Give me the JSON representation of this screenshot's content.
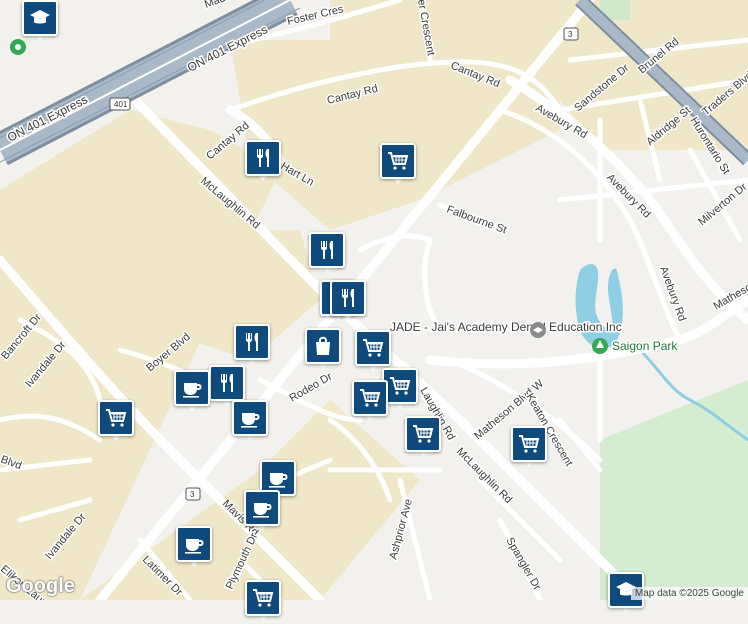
{
  "map": {
    "highway_labels": [
      "ON 401 Express",
      "ON 401 Express"
    ],
    "shields": [
      "401",
      "3",
      "3"
    ],
    "streets": [
      "Foster Cres",
      "Cantay Rd",
      "Cantay Rd",
      "McLaughlin Rd",
      "McLaughlin Rd",
      "McLaughlin Rd",
      "Avebury Rd",
      "Avebury Rd",
      "Avebury Rd",
      "Falbourne St",
      "Hurontario St",
      "Sandstone Dr",
      "Brunel Rd",
      "Traders Blvd",
      "Aldridge St",
      "Milverton Dr",
      "Matheson Blvd W",
      "Matheson Blvd W",
      "Bancroft Dr",
      "Ivandale Dr",
      "Ivandale Dr",
      "Blvd",
      "Boyer Blvd",
      "Rodeo Dr",
      "Mavis Rd",
      "Plymouth Dr",
      "Latimer Dr",
      "Ashprior Ave",
      "Spangler Dr",
      "Keaton Crescent",
      "Laughlin Rd",
      "Cantay Rd",
      "Hart Ln",
      "er Crescent",
      "Eliken Laumaw",
      "Mad"
    ],
    "poi_school": "JADE - Jai's Academy Dental Education Inc",
    "poi_park": "Saigon Park",
    "markers": [
      {
        "type": "school",
        "icon": "graduation-cap-icon"
      },
      {
        "type": "restaurant",
        "icon": "fork-knife-icon"
      },
      {
        "type": "grocery",
        "icon": "shopping-cart-icon"
      },
      {
        "type": "restaurant",
        "icon": "fork-knife-icon"
      },
      {
        "type": "restaurant",
        "icon": "fork-knife-icon"
      },
      {
        "type": "restaurant",
        "icon": "fork-knife-icon"
      },
      {
        "type": "restaurant",
        "icon": "fork-knife-icon"
      },
      {
        "type": "shopping",
        "icon": "shopping-bag-icon"
      },
      {
        "type": "grocery",
        "icon": "shopping-cart-icon"
      },
      {
        "type": "restaurant",
        "icon": "fork-knife-icon"
      },
      {
        "type": "cafe",
        "icon": "coffee-cup-icon"
      },
      {
        "type": "cafe",
        "icon": "coffee-cup-icon"
      },
      {
        "type": "grocery",
        "icon": "shopping-cart-icon"
      },
      {
        "type": "grocery",
        "icon": "shopping-cart-icon"
      },
      {
        "type": "grocery",
        "icon": "shopping-cart-icon"
      },
      {
        "type": "grocery",
        "icon": "shopping-cart-icon"
      },
      {
        "type": "grocery",
        "icon": "shopping-cart-icon"
      },
      {
        "type": "cafe",
        "icon": "coffee-cup-icon"
      },
      {
        "type": "cafe",
        "icon": "coffee-cup-icon"
      },
      {
        "type": "cafe",
        "icon": "coffee-cup-icon"
      },
      {
        "type": "grocery",
        "icon": "shopping-cart-icon"
      },
      {
        "type": "school",
        "icon": "graduation-cap-icon"
      }
    ]
  },
  "branding": {
    "logo": "Google",
    "attribution": "Map data ©2025 Google"
  },
  "colors": {
    "marker_fill": "#0f4a7c",
    "commercial_area": "#f0e6c8",
    "highway": "#8fa3b5",
    "park": "#d4ecd0",
    "water": "#8ecfe6"
  }
}
